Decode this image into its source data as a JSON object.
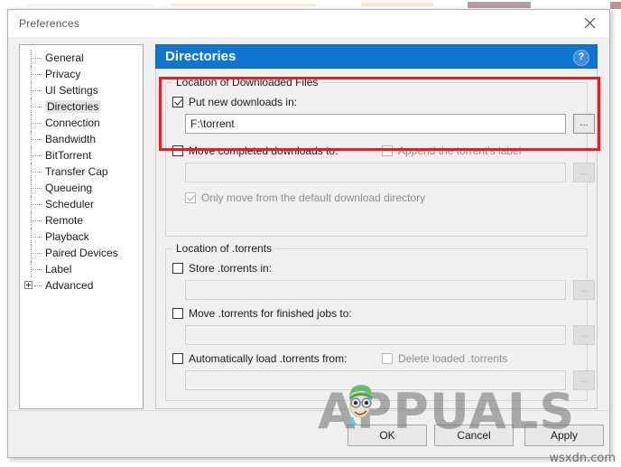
{
  "window": {
    "title": "Preferences",
    "close_label": "×"
  },
  "sidebar": {
    "items": [
      {
        "label": "General",
        "selected": false,
        "expandable": false
      },
      {
        "label": "Privacy",
        "selected": false,
        "expandable": false
      },
      {
        "label": "UI Settings",
        "selected": false,
        "expandable": false
      },
      {
        "label": "Directories",
        "selected": true,
        "expandable": false
      },
      {
        "label": "Connection",
        "selected": false,
        "expandable": false
      },
      {
        "label": "Bandwidth",
        "selected": false,
        "expandable": false
      },
      {
        "label": "BitTorrent",
        "selected": false,
        "expandable": false
      },
      {
        "label": "Transfer Cap",
        "selected": false,
        "expandable": false
      },
      {
        "label": "Queueing",
        "selected": false,
        "expandable": false
      },
      {
        "label": "Scheduler",
        "selected": false,
        "expandable": false
      },
      {
        "label": "Remote",
        "selected": false,
        "expandable": false
      },
      {
        "label": "Playback",
        "selected": false,
        "expandable": false
      },
      {
        "label": "Paired Devices",
        "selected": false,
        "expandable": false
      },
      {
        "label": "Label",
        "selected": false,
        "expandable": false
      },
      {
        "label": "Advanced",
        "selected": false,
        "expandable": true
      }
    ]
  },
  "panel": {
    "title": "Directories",
    "help_icon_label": "?",
    "groups": {
      "downloaded_files": {
        "title": "Location of Downloaded Files",
        "put_new_downloads": {
          "label": "Put new downloads in:",
          "checked": true,
          "enabled": true,
          "value": "F:\\torrent",
          "browse_label": "..."
        },
        "move_completed": {
          "label": "Move completed downloads to:",
          "checked": false,
          "enabled": true,
          "value": "",
          "browse_label": "..."
        },
        "append_label": {
          "label": "Append the torrent's label",
          "checked": false,
          "enabled": false
        },
        "only_move_default": {
          "label": "Only move from the default download directory",
          "checked": true,
          "enabled": false
        }
      },
      "torrents": {
        "title": "Location of .torrents",
        "store_torrents": {
          "label": "Store .torrents in:",
          "checked": false,
          "enabled": true,
          "value": "",
          "browse_label": "..."
        },
        "move_finished": {
          "label": "Move .torrents for finished jobs to:",
          "checked": false,
          "enabled": true,
          "value": "",
          "browse_label": "..."
        },
        "auto_load": {
          "label": "Automatically load .torrents from:",
          "checked": false,
          "enabled": true,
          "value": "",
          "browse_label": "..."
        },
        "delete_loaded": {
          "label": "Delete loaded .torrents",
          "checked": false,
          "enabled": false
        }
      }
    }
  },
  "buttons": {
    "ok": "OK",
    "cancel": "Cancel",
    "apply": "Apply"
  },
  "watermarks": {
    "appuals": "APPUALS",
    "site": "wsxdn.com"
  },
  "colors": {
    "panel_header_blue": "#0f75cf",
    "highlight_red": "#ed1c24",
    "window_background": "#f0f0f0",
    "selection_gray": "#e4e4e4"
  }
}
